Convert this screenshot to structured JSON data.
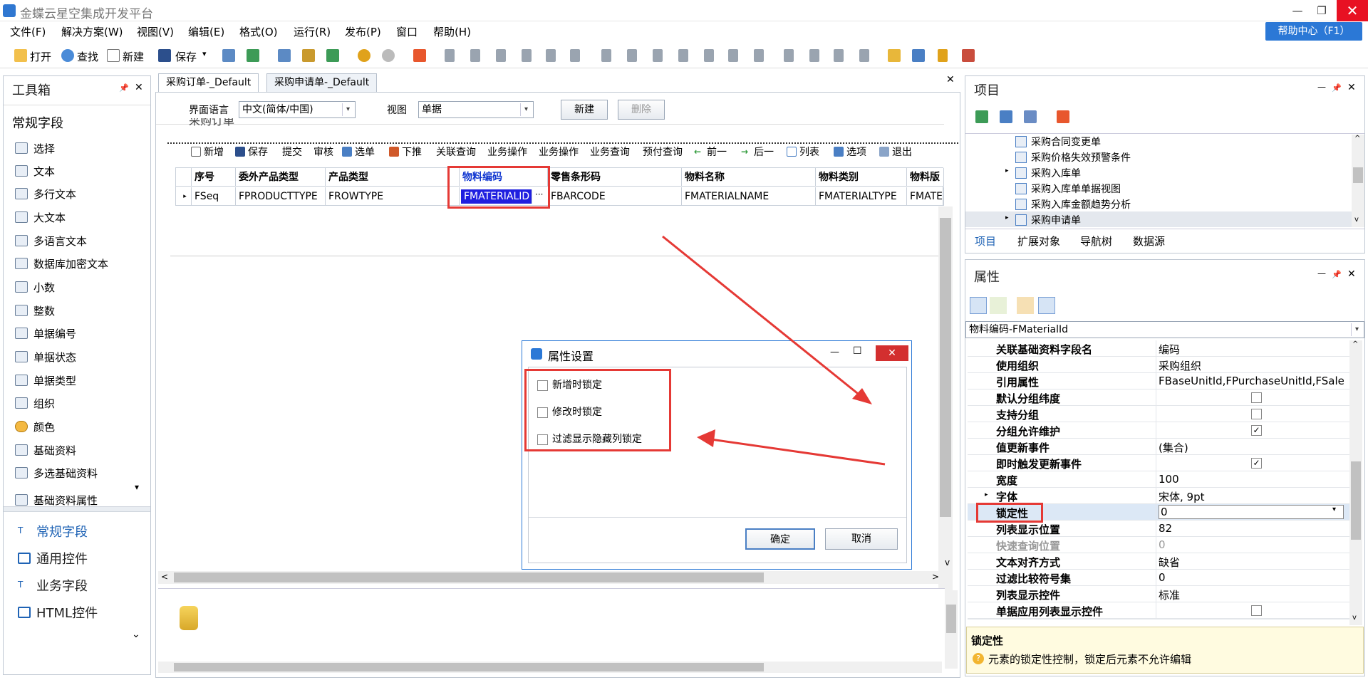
{
  "window": {
    "title": "金蝶云星空集成开发平台",
    "min": "—",
    "restore": "❐",
    "close": "✕"
  },
  "menu": [
    "文件(F)",
    "解决方案(W)",
    "视图(V)",
    "编辑(E)",
    "格式(O)",
    "运行(R)",
    "发布(P)",
    "窗口",
    "帮助(H)"
  ],
  "help_center": "帮助中心（F1）",
  "toolbar": {
    "open": "打开",
    "find": "查找",
    "new": "新建",
    "save": "保存",
    "save_arrow": "▾"
  },
  "toolbox": {
    "title": "工具箱",
    "pin": "📌",
    "close": "✕",
    "section": "常规字段",
    "items": [
      "选择",
      "文本",
      "多行文本",
      "大文本",
      "多语言文本",
      "数据库加密文本",
      "小数",
      "整数",
      "单据编号",
      "单据状态",
      "单据类型",
      "组织",
      "颜色",
      "基础资料",
      "多选基础资料",
      "基础资料属性"
    ],
    "categories": [
      "常规字段",
      "通用控件",
      "业务字段",
      "HTML控件"
    ],
    "scroll_down": "⌄",
    "list_arrow": "▾"
  },
  "doc_tabs": [
    "采购订单-_Default",
    "采购申请单-_Default"
  ],
  "doc_close": "✕",
  "designer": {
    "lang_label": "界面语言",
    "lang_value": "中文(简体/中国)",
    "view_label": "视图",
    "view_value": "单据",
    "new_btn": "新建",
    "delete_btn": "删除",
    "form_title": "采购订单",
    "dropdown_arrow": "▾",
    "row_marker": "▸",
    "ellipsis": "···",
    "bill_toolbar": [
      "新增",
      "保存",
      "提交",
      "审核",
      "选单",
      "下推",
      "关联查询",
      "业务操作",
      "业务操作",
      "业务查询",
      "预付查询",
      "前一",
      "后一",
      "列表",
      "选项",
      "退出"
    ],
    "grid_headers": [
      "序号",
      "委外产品类型",
      "产品类型",
      "物料编码",
      "零售条形码",
      "物料名称",
      "物料类别",
      "物料版"
    ],
    "grid_row": [
      "FSeq",
      "FPRODUCTTYPE",
      "FROWTYPE",
      "FMATERIALID",
      "FBARCODE",
      "FMATERIALNAME",
      "FMATERIALTYPE",
      "FMATE"
    ],
    "scroll_left": "<",
    "scroll_right": ">",
    "scroll_up": "^",
    "scroll_down": "v"
  },
  "dialog": {
    "title": "属性设置",
    "options": [
      "新增时锁定",
      "修改时锁定",
      "过滤显示隐藏列锁定"
    ],
    "ok": "确定",
    "cancel": "取消",
    "min": "—",
    "max": "☐",
    "close": "✕"
  },
  "project": {
    "title": "项目",
    "tree": [
      "采购合同变更单",
      "采购价格失效预警条件",
      "采购入库单",
      "采购入库单单据视图",
      "采购入库金额趋势分析",
      "采购申请单"
    ],
    "expander": "▸",
    "tabs": [
      "项目",
      "扩展对象",
      "导航树",
      "数据源"
    ],
    "scroll_up": "^",
    "scroll_down": "v"
  },
  "properties": {
    "title": "属性",
    "object": "物料编码-FMaterialId",
    "dropdown_arrow": "▾",
    "expander": "▸",
    "rows": [
      {
        "name": "关联基础资料字段名",
        "value": "编码"
      },
      {
        "name": "使用组织",
        "value": "采购组织"
      },
      {
        "name": "引用属性",
        "value": "FBaseUnitId,FPurchaseUnitId,FSaleP..."
      },
      {
        "name": "默认分组纬度",
        "check": ""
      },
      {
        "name": "支持分组",
        "check": ""
      },
      {
        "name": "分组允许维护",
        "check": "✓"
      },
      {
        "name": "值更新事件",
        "value": "(集合)"
      },
      {
        "name": "即时触发更新事件",
        "check": "✓"
      },
      {
        "name": "宽度",
        "value": "100"
      },
      {
        "name": "字体",
        "value": "宋体, 9pt"
      },
      {
        "name": "锁定性",
        "value": "0"
      },
      {
        "name": "列表显示位置",
        "value": "82"
      },
      {
        "name": "快速查询位置",
        "value": "0"
      },
      {
        "name": "文本对齐方式",
        "value": "缺省"
      },
      {
        "name": "过滤比较符号集",
        "value": "0"
      },
      {
        "name": "列表显示控件",
        "value": "标准"
      },
      {
        "name": "单据应用列表显示控件",
        "check": ""
      }
    ],
    "desc_title": "锁定性",
    "desc_text": "元素的锁定性控制，锁定后元素不允许编辑",
    "desc_icon": "?",
    "scroll_up": "^",
    "scroll_down": "v"
  },
  "panel_buttons": {
    "min": "—",
    "pin": "📌",
    "close": "✕"
  }
}
